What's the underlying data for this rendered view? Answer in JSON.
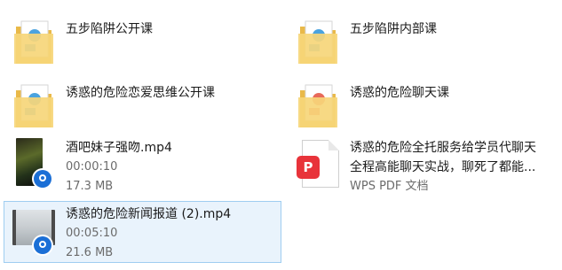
{
  "files": [
    {
      "name": "五步陷阱公开课",
      "type": "folder"
    },
    {
      "name": "五步陷阱内部课",
      "type": "folder"
    },
    {
      "name": "诱惑的危险恋爱思维公开课",
      "type": "folder"
    },
    {
      "name": "诱惑的危险聊天课",
      "type": "folder"
    },
    {
      "name": "酒吧妹子强吻.mp4",
      "type": "video",
      "duration": "00:00:10",
      "size": "17.3 MB"
    },
    {
      "name_line1": "诱惑的危险全托服务给学员代聊天",
      "name_line2": "全程高能聊天实战，聊死了都能...",
      "type": "pdf",
      "type_label": "WPS PDF 文档"
    },
    {
      "name": "诱惑的危险新闻报道 (2).mp4",
      "type": "video",
      "duration": "00:05:10",
      "size": "21.6 MB",
      "selected": true
    }
  ],
  "icons": {
    "folder": "folder-icon",
    "video": "video-file-icon",
    "pdf": "wps-pdf-icon"
  },
  "colors": {
    "folder_yellow": "#f6d67a",
    "folder_dark": "#e9b949",
    "selection_bg": "#e9f3fc",
    "selection_border": "#9fcdf1",
    "pdf_red": "#e8333a",
    "play_blue": "#1b6fd6"
  }
}
